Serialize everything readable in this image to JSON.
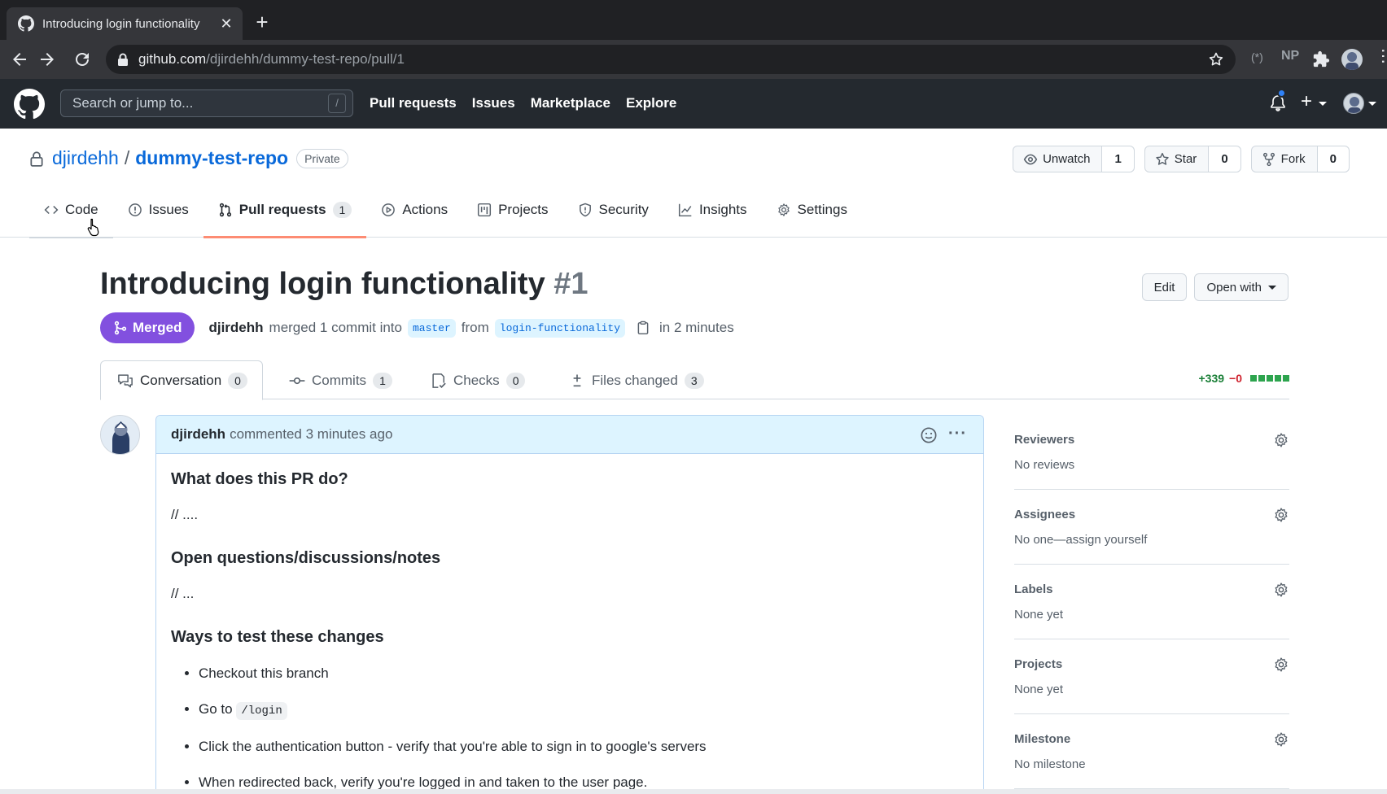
{
  "browser": {
    "tab_title": "Introducing login functionality",
    "tab_close": "✕",
    "new_tab": "+",
    "url_host": "github.com",
    "url_path": "/djirdehh/dummy-test-repo/pull/1",
    "extensions": [
      "(*)",
      "NP"
    ]
  },
  "gh_header": {
    "search_placeholder": "Search or jump to...",
    "search_shortcut": "/",
    "nav": [
      "Pull requests",
      "Issues",
      "Marketplace",
      "Explore"
    ],
    "plus": "+"
  },
  "repo": {
    "owner": "djirdehh",
    "separator": "/",
    "name": "dummy-test-repo",
    "visibility": "Private",
    "actions": [
      {
        "label": "Unwatch",
        "count": "1",
        "icon": "eye-icon"
      },
      {
        "label": "Star",
        "count": "0",
        "icon": "star-icon"
      },
      {
        "label": "Fork",
        "count": "0",
        "icon": "repo-forked-icon"
      }
    ],
    "tabs": [
      {
        "label": "Code",
        "icon": "code-icon"
      },
      {
        "label": "Issues",
        "icon": "issue-opened-icon"
      },
      {
        "label": "Pull requests",
        "count": "1",
        "icon": "git-pull-request-icon",
        "selected": true
      },
      {
        "label": "Actions",
        "icon": "play-icon"
      },
      {
        "label": "Projects",
        "icon": "project-icon"
      },
      {
        "label": "Security",
        "icon": "shield-icon"
      },
      {
        "label": "Insights",
        "icon": "graph-icon"
      },
      {
        "label": "Settings",
        "icon": "gear-icon"
      }
    ]
  },
  "pr": {
    "title": "Introducing login functionality",
    "number": "#1",
    "edit_label": "Edit",
    "open_with_label": "Open with",
    "state": "Merged",
    "author": "djirdehh",
    "merged_text": "merged 1 commit into",
    "base_branch": "master",
    "from_text": "from",
    "head_branch": "login-functionality",
    "time_text": "in 2 minutes",
    "tabs": [
      {
        "label": "Conversation",
        "count": "0",
        "icon": "comment-discussion-icon",
        "selected": true
      },
      {
        "label": "Commits",
        "count": "1",
        "icon": "git-commit-icon"
      },
      {
        "label": "Checks",
        "count": "0",
        "icon": "checklist-icon"
      },
      {
        "label": "Files changed",
        "count": "3",
        "icon": "file-diff-icon"
      }
    ],
    "additions": "+339",
    "deletions": "−0",
    "diff_color": "#2da44e",
    "state_color": "#8250df"
  },
  "comment": {
    "author": "djirdehh",
    "meta": "commented 3 minutes ago",
    "heading_1": "What does this PR do?",
    "text_1": "// ....",
    "heading_2": "Open questions/discussions/notes",
    "text_2": "// ...",
    "heading_3": "Ways to test these changes",
    "list": [
      "Checkout this branch",
      "Go to",
      "Click the authentication button - verify that you're able to sign in to google's servers",
      "When redirected back, verify you're logged in and taken to the user page."
    ],
    "list_code": "/login"
  },
  "sidebar": [
    {
      "title": "Reviewers",
      "value": "No reviews"
    },
    {
      "title": "Assignees",
      "value": "No one—assign yourself"
    },
    {
      "title": "Labels",
      "value": "None yet"
    },
    {
      "title": "Projects",
      "value": "None yet"
    },
    {
      "title": "Milestone",
      "value": "No milestone"
    }
  ]
}
